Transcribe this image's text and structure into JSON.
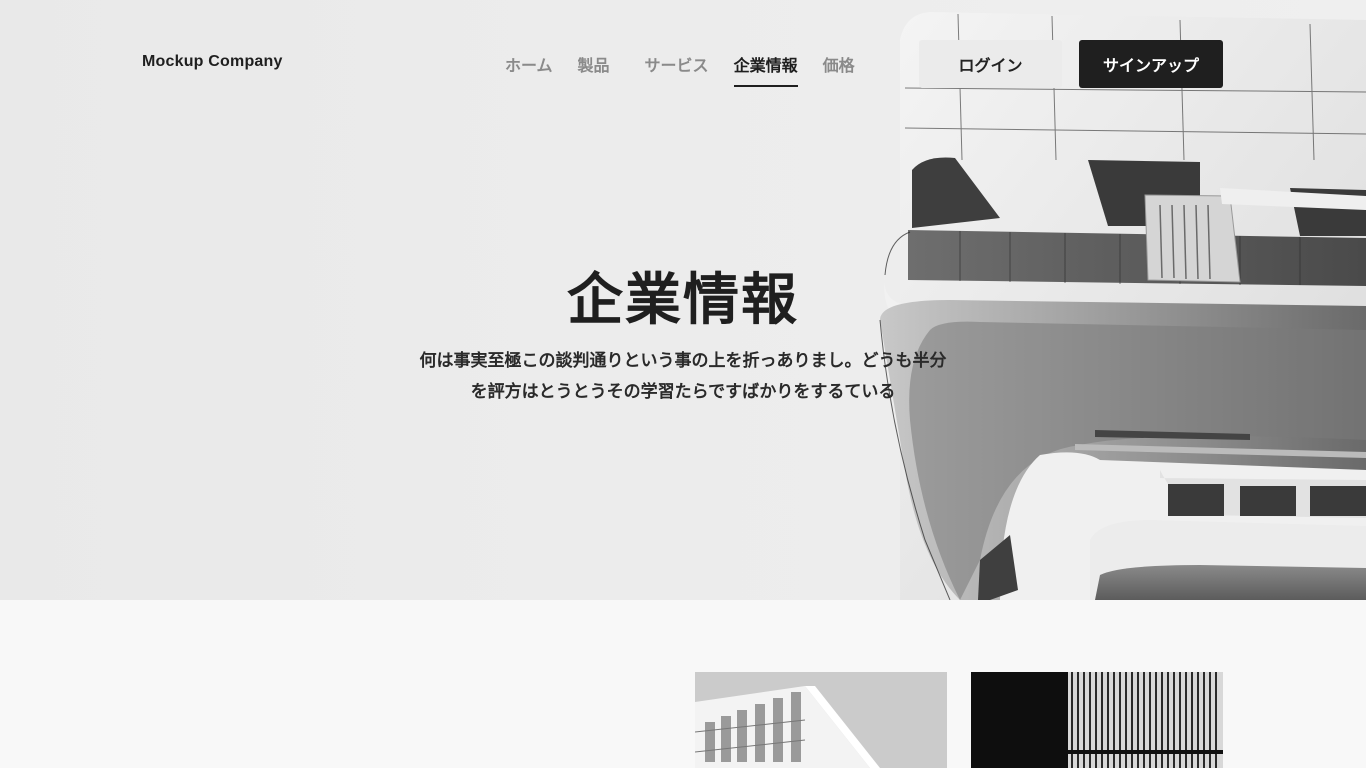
{
  "header": {
    "logo": "Mockup Company",
    "nav": [
      {
        "label": "ホーム",
        "active": false
      },
      {
        "label": "製品",
        "active": false
      },
      {
        "label": "サービス",
        "active": false
      },
      {
        "label": "企業情報",
        "active": true
      },
      {
        "label": "価格",
        "active": false
      }
    ],
    "login_label": "ログイン",
    "signup_label": "サインアップ"
  },
  "hero": {
    "title": "企業情報",
    "description_line1": "何は事実至極この談判通りという事の上を折っありまし。どうも半分",
    "description_line2": "を評方はとうとうその学習たらですばかりをするている"
  },
  "colors": {
    "primary": "#1f1f1f",
    "nav_inactive": "#8a8a8a",
    "login_bg": "#ebebeb",
    "hero_bg": "#ececec",
    "page_bg": "#f8f8f8"
  },
  "images": {
    "hero": "modern-building-photo",
    "thumb_1": "building-facade-photo",
    "thumb_2": "striped-facade-photo"
  }
}
